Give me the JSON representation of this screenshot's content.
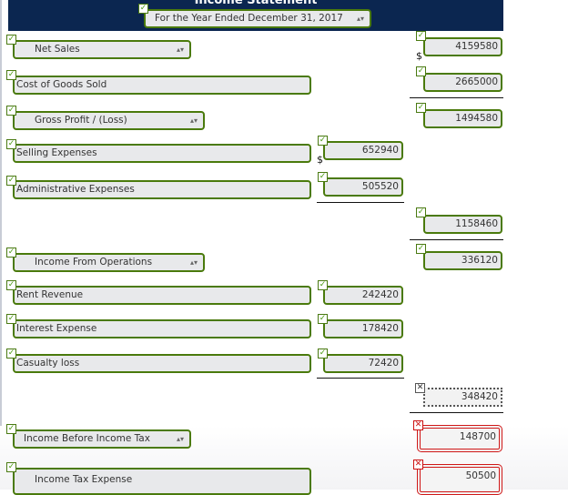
{
  "header": {
    "title": "Income Statement",
    "period_select": "For the Year Ended December 31, 2017"
  },
  "rows": {
    "net_sales": {
      "label": "Net Sales",
      "value": "4159580",
      "currency": "$"
    },
    "cogs": {
      "label": "Cost of Goods Sold",
      "value": "2665000"
    },
    "gross_profit": {
      "label": "Gross Profit / (Loss)",
      "value": "1494580"
    },
    "selling": {
      "label": "Selling Expenses",
      "value": "652940",
      "currency": "$"
    },
    "admin": {
      "label": "Administrative Expenses",
      "value": "505520"
    },
    "total_opex": {
      "value": "1158460"
    },
    "income_ops": {
      "label": "Income From Operations",
      "value": "336120"
    },
    "rent": {
      "label": "Rent Revenue",
      "value": "242420"
    },
    "interest": {
      "label": "Interest Expense",
      "value": "178420"
    },
    "casualty": {
      "label": "Casualty loss",
      "value": "72420"
    },
    "other_total": {
      "value": "348420",
      "status": "incorrect"
    },
    "income_before_tax": {
      "label": "Income Before Income Tax",
      "value": "148700",
      "status": "incorrect"
    },
    "income_tax": {
      "label": "Income Tax Expense",
      "value": "50500",
      "status": "incorrect"
    }
  },
  "marks": {
    "check": "✓",
    "cross": "✕",
    "updown": "▴▾"
  },
  "colors": {
    "header_bg": "#0b2650",
    "correct_border": "#4a7a0c",
    "incorrect_border": "#d01818"
  }
}
